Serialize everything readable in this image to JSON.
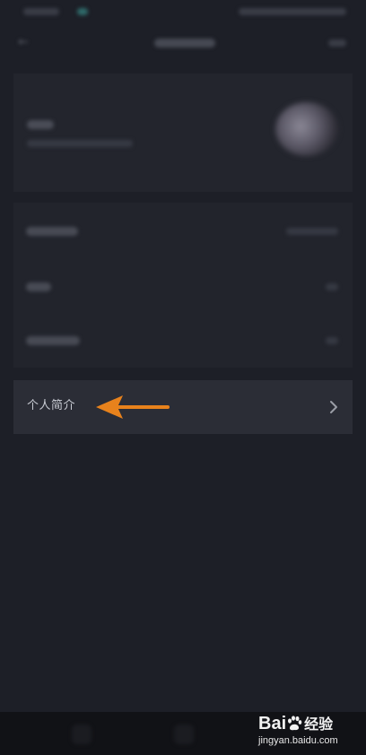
{
  "intro_row": {
    "label": "个人简介",
    "chevron_icon": "chevron-right-icon"
  },
  "annotation": {
    "arrow_icon": "arrow-left-icon",
    "arrow_color": "#e8821c"
  },
  "watermark": {
    "brand": "Bai",
    "brand_tail": "经验",
    "url": "jingyan.baidu.com"
  },
  "colors": {
    "background": "#1d1f27",
    "card": "#22242c",
    "highlight_row": "#2b2d36"
  }
}
